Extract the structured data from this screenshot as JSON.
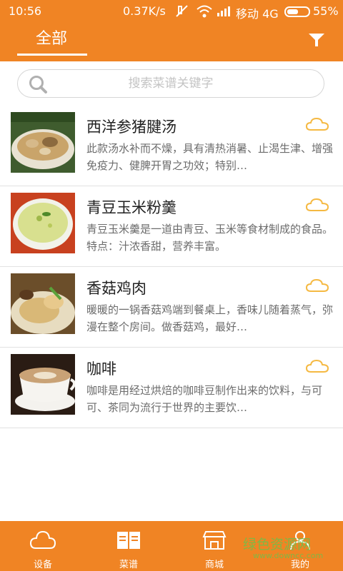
{
  "status_bar": {
    "time": "10:56",
    "speed": "0.37K/s",
    "carrier": "移动 4G",
    "battery": "55%",
    "battery_level": 0.55
  },
  "header": {
    "tab_all": "全部",
    "filter_icon": "filter-icon"
  },
  "search": {
    "placeholder": "搜索菜谱关键字"
  },
  "recipes": [
    {
      "title": "西洋参猪腱汤",
      "desc": "此款汤水补而不燥，具有清热消暑、止渴生津、增强免疫力、健脾开胃之功效；特别…"
    },
    {
      "title": "青豆玉米粉羹",
      "desc": "青豆玉米羹是一道由青豆、玉米等食材制成的食品。特点：汁浓香甜，营养丰富。"
    },
    {
      "title": "香菇鸡肉",
      "desc": "暖暖的一锅香菇鸡端到餐桌上，香味儿随着蒸气，弥漫在整个房间。做香菇鸡，最好…"
    },
    {
      "title": "咖啡",
      "desc": "咖啡是用经过烘焙的咖啡豆制作出来的饮料，与可可、茶同为流行于世界的主要饮…"
    }
  ],
  "bottom_nav": [
    {
      "label": "设备",
      "icon": "cloud-icon"
    },
    {
      "label": "菜谱",
      "icon": "book-icon"
    },
    {
      "label": "商城",
      "icon": "shop-icon"
    },
    {
      "label": "我的",
      "icon": "user-icon"
    }
  ],
  "watermark": {
    "text": "绿色资源网",
    "url": "www.downcc.com"
  },
  "colors": {
    "accent": "#f08424",
    "cloud": "#f5b942"
  }
}
